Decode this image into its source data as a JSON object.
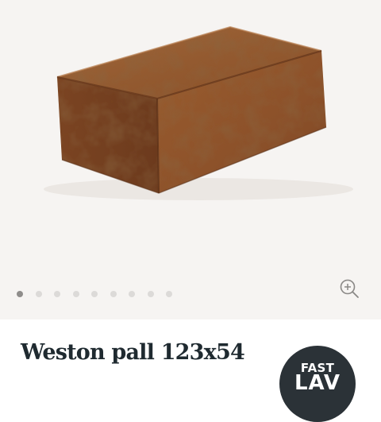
{
  "product": {
    "title": "Weston pall 123x54",
    "image_icon": "ottoman-photo"
  },
  "gallery": {
    "dot_count": 9,
    "active_index": 0,
    "zoom_icon": "zoom-in-icon"
  },
  "badge": {
    "line1": "FAST",
    "line2": "LAV"
  },
  "colors": {
    "leather": "#93552a",
    "gallery_bg": "#f6f4f2",
    "dot_active": "#8f8d8b",
    "dot_inactive": "#dcdad8",
    "title": "#1f2a30",
    "badge_bg": "#2b3237"
  }
}
